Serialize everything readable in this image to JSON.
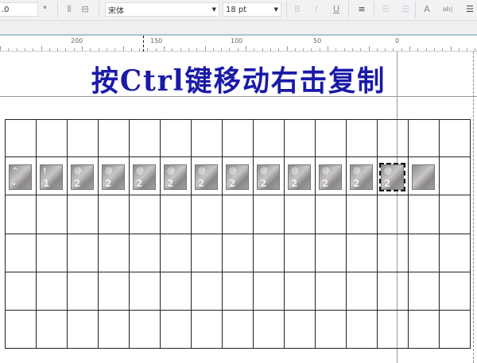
{
  "toolbar": {
    "angle_value": ".0",
    "degree_symbol": "°",
    "font_name": "宋体",
    "font_size": "18 pt",
    "icons": [
      "mirror-h-icon",
      "mirror-v-icon",
      "bold-icon",
      "italic-icon",
      "underline-icon",
      "align-icon",
      "bullet-list-icon",
      "numbered-list-icon",
      "text-properties-icon",
      "edit-text-icon",
      "menu-icon"
    ]
  },
  "ruler": {
    "labels": [
      "200",
      "150",
      "100",
      "50",
      "0"
    ]
  },
  "canvas": {
    "title": "按Ctrl键移动右击复制",
    "title_color": "#1a1aa8",
    "keys": [
      {
        "top": "^",
        "bottom": "-"
      },
      {
        "top": "!",
        "bottom": "1"
      },
      {
        "top": "@",
        "bottom": "2"
      },
      {
        "top": "@",
        "bottom": "2"
      },
      {
        "top": "@",
        "bottom": "2"
      },
      {
        "top": "@",
        "bottom": "2"
      },
      {
        "top": "@",
        "bottom": "2"
      },
      {
        "top": "@",
        "bottom": "2"
      },
      {
        "top": "@",
        "bottom": "2"
      },
      {
        "top": "@",
        "bottom": "2"
      },
      {
        "top": "@",
        "bottom": "2"
      },
      {
        "top": "@",
        "bottom": "2"
      },
      {
        "top": "@",
        "bottom": "2"
      },
      {
        "top": "",
        "bottom": ""
      }
    ],
    "grid_columns": 15,
    "grid_rows": 6
  }
}
